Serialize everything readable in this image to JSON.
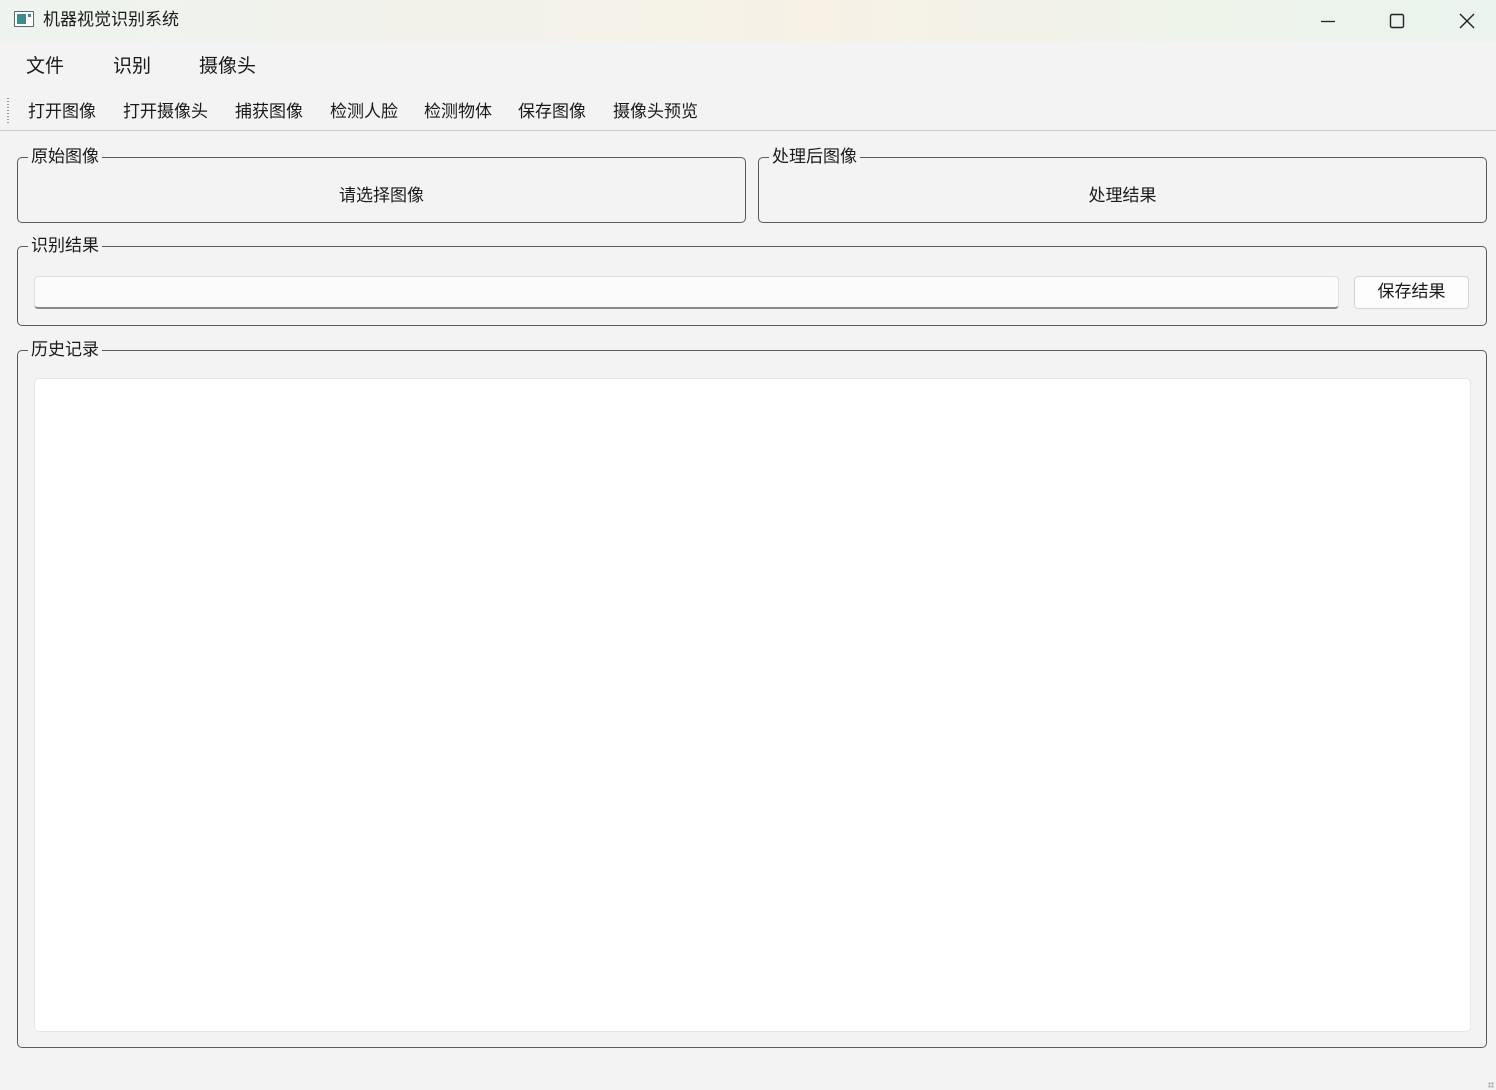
{
  "window": {
    "title": "机器视觉识别系统"
  },
  "menubar": {
    "items": [
      {
        "label": "文件"
      },
      {
        "label": "识别"
      },
      {
        "label": "摄像头"
      }
    ]
  },
  "toolbar": {
    "items": [
      {
        "label": "打开图像"
      },
      {
        "label": "打开摄像头"
      },
      {
        "label": "捕获图像"
      },
      {
        "label": "检测人脸"
      },
      {
        "label": "检测物体"
      },
      {
        "label": "保存图像"
      },
      {
        "label": "摄像头预览"
      }
    ]
  },
  "original_group": {
    "title": "原始图像",
    "placeholder": "请选择图像"
  },
  "processed_group": {
    "title": "处理后图像",
    "placeholder": "处理结果"
  },
  "result_group": {
    "title": "识别结果",
    "value": "",
    "save_label": "保存结果"
  },
  "history_group": {
    "title": "历史记录",
    "entries": []
  },
  "colors": {
    "window_bg": "#f3f3f3",
    "border": "#5a5a5a",
    "icon_accent": "#3f8a8c"
  }
}
